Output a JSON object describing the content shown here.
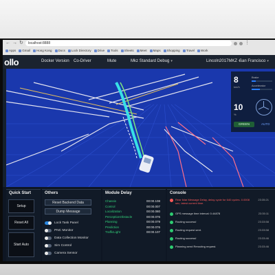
{
  "browser": {
    "url": "localhost:8888",
    "bookmarks": [
      "Apps",
      "Gmail",
      "Hong Kong",
      "Docs",
      "Lock Directory",
      "Drive",
      "Tools",
      "Sheets",
      "Meet",
      "Maps",
      "Shopping",
      "Travel",
      "Work"
    ]
  },
  "header": {
    "logo": "ollo",
    "docker_version": "Docker Version",
    "mode": "Co-Driver",
    "mute": "Mute",
    "hd_map": "Mkz Standard Debug",
    "vehicle": "Lincoln2017MKZ",
    "map": "San Francisco"
  },
  "status": {
    "speed": "8",
    "speed_unit": "km/h",
    "brake_label": "Brake",
    "accelerator_label": "Accelerator",
    "steering": "10",
    "steering_unit": "%",
    "signal": "GREEN",
    "driving_mode": "AUTO",
    "brake_level": 0.2,
    "accelerator_level": 0.4
  },
  "quick_start": {
    "title": "Quick Start",
    "buttons": [
      "Setup",
      "Reset All",
      "Start Auto"
    ]
  },
  "others": {
    "title": "Others",
    "buttons": [
      "Reset Backend Data",
      "Dump Message"
    ],
    "toggles": [
      {
        "label": "Lock Task Panel",
        "on": true
      },
      {
        "label": "PNC Monitor",
        "on": false
      },
      {
        "label": "Data Collection Monitor",
        "on": false
      },
      {
        "label": "Sim Control",
        "on": false
      },
      {
        "label": "Camera Sensor",
        "on": false
      }
    ]
  },
  "module_delay": {
    "title": "Module Delay",
    "rows": [
      {
        "name": "Chassis",
        "value": "00:00.108"
      },
      {
        "name": "Control",
        "value": "00:00.007"
      },
      {
        "name": "Localization",
        "value": "00:00.080"
      },
      {
        "name": "PerceptionObstacle",
        "value": "00:00.076"
      },
      {
        "name": "Planning",
        "value": "00:00.079"
      },
      {
        "name": "Prediction",
        "value": "00:00.076"
      },
      {
        "name": "TrafficLight",
        "value": "00:00.107"
      }
    ]
  },
  "console": {
    "title": "Console",
    "messages": [
      {
        "level": "error",
        "text": "Rear lidar Message Delay, delay cycle for 640 cycles. 0.0008 sec, latest current time.",
        "time": "23:35:21"
      },
      {
        "level": "info",
        "text": "GPS message time interval: 0.44878",
        "time": "23:35:11"
      },
      {
        "level": "info",
        "text": "Routing success!",
        "time": "23:33:58"
      },
      {
        "level": "info",
        "text": "Routing request sent.",
        "time": "23:33:58"
      },
      {
        "level": "info",
        "text": "Routing success!",
        "time": "23:33:46"
      },
      {
        "level": "info",
        "text": "Planning send Rerouting request.",
        "time": "23:33:46"
      }
    ]
  },
  "colors": {
    "scene_bg": "#1a38ad",
    "lane_white": "#e6e6f0",
    "lane_yellow": "#e8c05a",
    "lane_red": "#ff6f8a",
    "path_cyan": "#38e0e6",
    "path_green": "#7ee87e",
    "delay_green": "#33d17a",
    "console_error": "#ff5a5a",
    "console_info": "#2ecc71"
  }
}
